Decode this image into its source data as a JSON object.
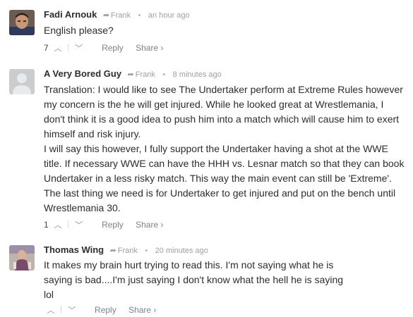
{
  "comments": [
    {
      "author": "Fadi Arnouk",
      "reply_to": "Frank",
      "time": "an hour ago",
      "paragraphs": [
        "English please?"
      ],
      "votes": "7",
      "reply_label": "Reply",
      "share_label": "Share ›"
    },
    {
      "author": "A Very Bored Guy",
      "reply_to": "Frank",
      "time": "8 minutes ago",
      "paragraphs": [
        "Translation: I would like to see The Undertaker perform at Extreme Rules however my concern is the he will get injured. While he looked great at Wrestlemania, I don't think it is a good idea to push him into a match which will cause him to exert himself and risk injury.",
        "I will say this however, I fully support the Undertaker having a shot at the WWE title. If necessary WWE can have the HHH vs. Lesnar match so that they can book Undertaker in a less risky match. This way the main event can still be 'Extreme'. The last thing we need is for Undertaker to get injured and put on the bench until Wrestlemania 30."
      ],
      "votes": "1",
      "reply_label": "Reply",
      "share_label": "Share ›"
    },
    {
      "author": "Thomas Wing",
      "reply_to": "Frank",
      "time": "20 minutes ago",
      "paragraphs": [
        "It makes my brain hurt trying to read this. I'm not saying what he is saying is bad....I'm just saying I don't know what the hell he is saying lol"
      ],
      "votes": "",
      "reply_label": "Reply",
      "share_label": "Share ›"
    }
  ],
  "icons": {
    "reply_arrow": "reply-arrow-icon",
    "upvote": "upvote-icon",
    "downvote": "downvote-icon"
  },
  "colors": {
    "author": "#2a2e2e",
    "meta": "#9aa0a4",
    "text": "#2a2e2e",
    "actions": "#848b90"
  }
}
